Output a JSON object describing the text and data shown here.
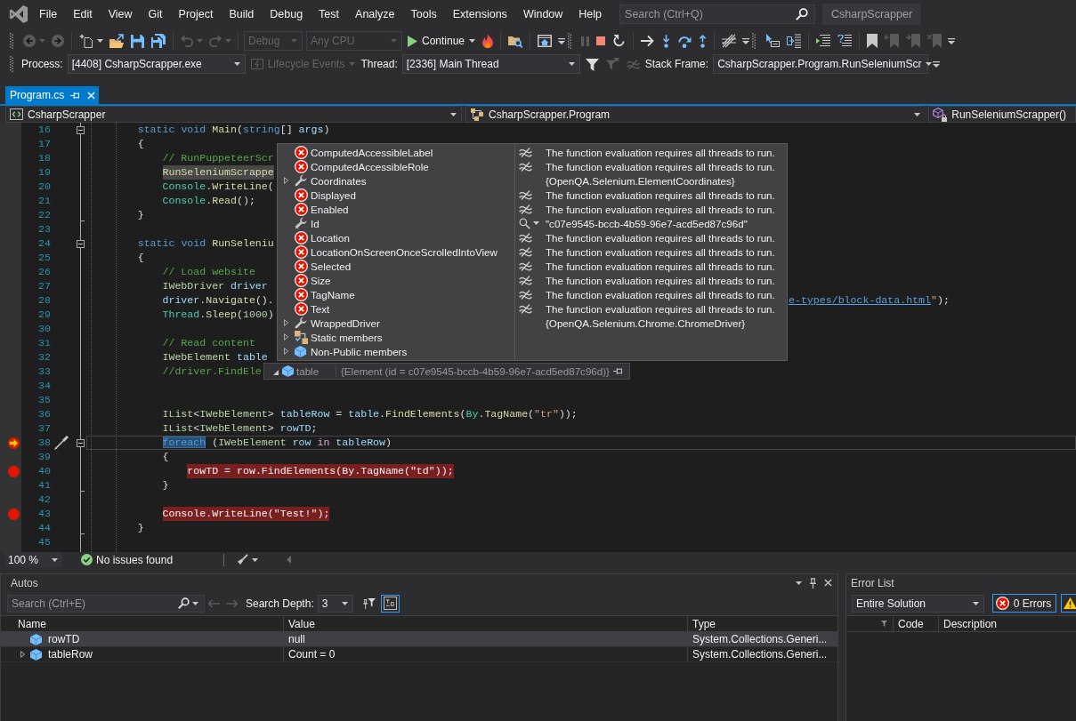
{
  "menu_bar": {
    "items": [
      "File",
      "Edit",
      "View",
      "Git",
      "Project",
      "Build",
      "Debug",
      "Test",
      "Analyze",
      "Tools",
      "Extensions",
      "Window",
      "Help"
    ],
    "search": {
      "placeholder": "Search (Ctrl+Q)"
    },
    "solution_name": "CsharpScrapper"
  },
  "toolbars": [
    [
      [
        [
          {
            "kind": "back",
            "disabled": true
          },
          {
            "kind": "caret",
            "disabled": true
          },
          {
            "kind": "forward",
            "disabled": true
          }
        ],
        [
          {
            "kind": "new_project",
            "disabled": false
          },
          {
            "kind": "caret",
            "disabled": false
          },
          {
            "kind": "open",
            "disabled": false
          },
          {
            "kind": "save",
            "disabled": false
          },
          {
            "kind": "save_all",
            "disabled": false
          }
        ],
        [
          {
            "kind": "undo",
            "disabled": true
          },
          {
            "kind": "caret",
            "disabled": true
          },
          {
            "kind": "redo",
            "disabled": true
          },
          {
            "kind": "caret",
            "disabled": true
          }
        ],
        [
          {
            "kind": "combo",
            "value": "Debug",
            "disabled": true
          },
          {
            "kind": "combo",
            "value": "Any CPU",
            "disabled": true
          },
          {
            "kind": "continue",
            "label": "Continue",
            "disabled": false
          },
          {
            "kind": "hot_reload",
            "disabled": false
          }
        ],
        [
          {
            "kind": "find_folder",
            "disabled": false
          }
        ],
        [
          {
            "kind": "app_window",
            "disabled": false
          }
        ]
      ],
      [
        [
          {
            "kind": "pause",
            "disabled": true
          },
          {
            "kind": "stop",
            "disabled": false
          },
          {
            "kind": "restart",
            "disabled": false
          }
        ],
        [
          {
            "kind": "show_next",
            "disabled": false
          },
          {
            "kind": "step_into",
            "disabled": false
          },
          {
            "kind": "step_over",
            "disabled": false
          },
          {
            "kind": "step_out",
            "disabled": false
          }
        ],
        [
          {
            "kind": "threads",
            "disabled": false
          }
        ]
      ],
      [
        [
          {
            "kind": "pointer_box",
            "disabled": false
          },
          {
            "kind": "stack_box",
            "disabled": false
          }
        ],
        [
          {
            "kind": "lines",
            "disabled": false
          },
          {
            "kind": "help_lines",
            "disabled": false
          }
        ],
        [
          {
            "kind": "bookmark",
            "disabled": false
          },
          {
            "kind": "bookmark_prev",
            "disabled": true
          },
          {
            "kind": "bookmark_next",
            "disabled": true
          },
          {
            "kind": "bookmark_clear",
            "disabled": true
          }
        ]
      ]
    ],
    [
      [
        [
          {
            "kind": "label",
            "text": "Process:"
          },
          {
            "kind": "combo",
            "value": "[4408] CsharpScrapper.exe",
            "disabled": false
          },
          {
            "kind": "lifecycle",
            "label": "Lifecycle Events",
            "disabled": true
          },
          {
            "kind": "label",
            "text": "Thread:"
          },
          {
            "kind": "combo",
            "value": "[2336] Main Thread",
            "disabled": false
          },
          {
            "kind": "filter",
            "disabled": false
          },
          {
            "kind": "flag_filter",
            "disabled": true
          },
          {
            "kind": "flag_clear",
            "disabled": true
          },
          {
            "kind": "label",
            "text": "Stack Frame:"
          },
          {
            "kind": "combo",
            "value": "CsharpScrapper.Program.RunSeleniumScr",
            "disabled": false
          }
        ]
      ]
    ]
  ],
  "document_tabs": [
    {
      "label": "Program.cs",
      "selected": true
    }
  ],
  "navigation_bar": [
    {
      "kind": "project",
      "text": "CsharpScrapper"
    },
    {
      "kind": "class",
      "text": "CsharpScrapper.Program"
    },
    {
      "kind": "method",
      "text": "RunSeleniumScrapper()"
    }
  ],
  "editor": {
    "lines": [
      {
        "number": "16",
        "kind": "fold_start",
        "breakpoint": false,
        "current": false,
        "call_site": false,
        "code": [
          {
            "text": "        static ",
            "kind": "keyword"
          },
          {
            "text": "void ",
            "kind": "keyword"
          },
          {
            "text": "Main",
            "kind": "method"
          },
          {
            "text": "(",
            "kind": "punct"
          },
          {
            "text": "string",
            "kind": "keyword"
          },
          {
            "text": "[] ",
            "kind": "punct"
          },
          {
            "text": "args",
            "kind": "variable"
          },
          {
            "text": ")",
            "kind": "punct"
          }
        ]
      },
      {
        "number": "17",
        "kind": "plain",
        "breakpoint": false,
        "current": false,
        "call_site": false,
        "code": [
          {
            "text": "        {",
            "kind": "punct"
          }
        ]
      },
      {
        "number": "18",
        "kind": "plain",
        "breakpoint": false,
        "current": false,
        "call_site": false,
        "code": [
          {
            "text": "            // RunPuppeteerScr",
            "kind": "comment"
          }
        ]
      },
      {
        "number": "19",
        "kind": "plain",
        "breakpoint": false,
        "current": false,
        "call_site": true,
        "code": [
          {
            "text": "            RunSeleniumScrappe",
            "kind": "method"
          }
        ]
      },
      {
        "number": "20",
        "kind": "plain",
        "breakpoint": false,
        "current": false,
        "call_site": false,
        "code": [
          {
            "text": "            Console",
            "kind": "type"
          },
          {
            "text": ".",
            "kind": "punct"
          },
          {
            "text": "WriteLine",
            "kind": "method"
          },
          {
            "text": "(",
            "kind": "punct"
          }
        ]
      },
      {
        "number": "21",
        "kind": "plain",
        "breakpoint": false,
        "current": false,
        "call_site": false,
        "code": [
          {
            "text": "            Console",
            "kind": "type"
          },
          {
            "text": ".",
            "kind": "punct"
          },
          {
            "text": "Read",
            "kind": "method"
          },
          {
            "text": "();",
            "kind": "punct"
          }
        ]
      },
      {
        "number": "22",
        "kind": "block_end",
        "breakpoint": false,
        "current": false,
        "call_site": false,
        "code": [
          {
            "text": "        }",
            "kind": "punct"
          }
        ]
      },
      {
        "number": "23",
        "kind": "plain",
        "breakpoint": false,
        "current": false,
        "call_site": false
      },
      {
        "number": "24",
        "kind": "fold_start",
        "breakpoint": false,
        "current": false,
        "call_site": false,
        "code": [
          {
            "text": "        static ",
            "kind": "keyword"
          },
          {
            "text": "void ",
            "kind": "keyword"
          },
          {
            "text": "RunSeleniu",
            "kind": "method"
          }
        ]
      },
      {
        "number": "25",
        "kind": "plain",
        "breakpoint": false,
        "current": false,
        "call_site": false,
        "code": [
          {
            "text": "        {",
            "kind": "punct"
          }
        ]
      },
      {
        "number": "26",
        "kind": "plain",
        "breakpoint": false,
        "current": false,
        "call_site": false,
        "code": [
          {
            "text": "            // Load website",
            "kind": "comment"
          }
        ]
      },
      {
        "number": "27",
        "kind": "plain",
        "breakpoint": false,
        "current": false,
        "call_site": false,
        "code": [
          {
            "text": "            IWebDriver ",
            "kind": "interface"
          },
          {
            "text": "driver",
            "kind": "variable"
          }
        ]
      },
      {
        "number": "28",
        "kind": "plain",
        "breakpoint": false,
        "current": false,
        "call_site": false,
        "code": [
          {
            "text": "            driver",
            "kind": "variable"
          },
          {
            "text": ".",
            "kind": "punct"
          },
          {
            "text": "Navigate",
            "kind": "method"
          },
          {
            "text": "().",
            "kind": "punct"
          }
        ],
        "after_tip": [
          {
            "text": "e-types/block-data.html",
            "kind": "link"
          },
          {
            "text": "\"",
            "kind": "string"
          },
          {
            "text": ");",
            "kind": "punct"
          }
        ]
      },
      {
        "number": "29",
        "kind": "plain",
        "breakpoint": false,
        "current": false,
        "call_site": false,
        "code": [
          {
            "text": "            Thread",
            "kind": "type"
          },
          {
            "text": ".",
            "kind": "punct"
          },
          {
            "text": "Sleep",
            "kind": "method"
          },
          {
            "text": "(",
            "kind": "punct"
          },
          {
            "text": "1000",
            "kind": "number"
          },
          {
            "text": ")",
            "kind": "punct"
          }
        ]
      },
      {
        "number": "30",
        "kind": "plain",
        "breakpoint": false,
        "current": false,
        "call_site": false
      },
      {
        "number": "31",
        "kind": "plain",
        "breakpoint": false,
        "current": false,
        "call_site": false,
        "code": [
          {
            "text": "            // Read content",
            "kind": "comment"
          }
        ]
      },
      {
        "number": "32",
        "kind": "plain",
        "breakpoint": false,
        "current": false,
        "call_site": false,
        "code": [
          {
            "text": "            IWebElement ",
            "kind": "interface"
          },
          {
            "text": "table",
            "kind": "variable"
          }
        ]
      },
      {
        "number": "33",
        "kind": "plain",
        "breakpoint": false,
        "current": false,
        "call_site": false,
        "code": [
          {
            "text": "            //driver.FindEle",
            "kind": "comment"
          }
        ]
      },
      {
        "number": "34",
        "kind": "plain",
        "breakpoint": false,
        "current": false,
        "call_site": false
      },
      {
        "number": "35",
        "kind": "plain",
        "breakpoint": false,
        "current": false,
        "call_site": false
      },
      {
        "number": "36",
        "kind": "plain",
        "breakpoint": false,
        "current": false,
        "call_site": false,
        "code": [
          {
            "text": "            IList",
            "kind": "interface"
          },
          {
            "text": "<",
            "kind": "punct"
          },
          {
            "text": "IWebElement",
            "kind": "interface"
          },
          {
            "text": "> ",
            "kind": "punct"
          },
          {
            "text": "tableRow",
            "kind": "variable"
          },
          {
            "text": " = ",
            "kind": "punct"
          },
          {
            "text": "table",
            "kind": "variable"
          },
          {
            "text": ".",
            "kind": "punct"
          },
          {
            "text": "FindElements",
            "kind": "method"
          },
          {
            "text": "(",
            "kind": "punct"
          },
          {
            "text": "By",
            "kind": "type"
          },
          {
            "text": ".",
            "kind": "punct"
          },
          {
            "text": "TagName",
            "kind": "method"
          },
          {
            "text": "(",
            "kind": "punct"
          },
          {
            "text": "\"tr\"",
            "kind": "string"
          },
          {
            "text": "));",
            "kind": "punct"
          }
        ]
      },
      {
        "number": "37",
        "kind": "plain",
        "breakpoint": false,
        "current": false,
        "call_site": false,
        "code": [
          {
            "text": "            IList",
            "kind": "interface"
          },
          {
            "text": "<",
            "kind": "punct"
          },
          {
            "text": "IWebElement",
            "kind": "interface"
          },
          {
            "text": "> ",
            "kind": "punct"
          },
          {
            "text": "rowTD",
            "kind": "variable"
          },
          {
            "text": ";",
            "kind": "punct"
          }
        ]
      },
      {
        "number": "38",
        "kind": "fold_start",
        "breakpoint": true,
        "current": true,
        "call_site": false,
        "code": [
          {
            "text": "            foreach",
            "kind": "selected"
          },
          {
            "text": " (",
            "kind": "punct"
          },
          {
            "text": "IWebElement ",
            "kind": "interface"
          },
          {
            "text": "row ",
            "kind": "variable"
          },
          {
            "text": "in ",
            "kind": "control"
          },
          {
            "text": "tableRow",
            "kind": "variable"
          },
          {
            "text": ")",
            "kind": "punct"
          }
        ]
      },
      {
        "number": "39",
        "kind": "plain",
        "breakpoint": false,
        "current": false,
        "call_site": false,
        "code": [
          {
            "text": "            {",
            "kind": "punct"
          }
        ]
      },
      {
        "number": "40",
        "kind": "plain",
        "breakpoint": true,
        "current": false,
        "call_site": false,
        "code": [
          {
            "text": "                rowTD",
            "kind": "variable"
          },
          {
            "text": " = ",
            "kind": "punct"
          },
          {
            "text": "row",
            "kind": "variable"
          },
          {
            "text": ".",
            "kind": "punct"
          },
          {
            "text": "FindElements",
            "kind": "method"
          },
          {
            "text": "(",
            "kind": "punct"
          },
          {
            "text": "By",
            "kind": "type"
          },
          {
            "text": ".",
            "kind": "punct"
          },
          {
            "text": "TagName",
            "kind": "method"
          },
          {
            "text": "(",
            "kind": "punct"
          },
          {
            "text": "\"td\"",
            "kind": "string"
          },
          {
            "text": "));",
            "kind": "punct"
          }
        ]
      },
      {
        "number": "41",
        "kind": "block_end",
        "breakpoint": false,
        "current": false,
        "call_site": false,
        "code": [
          {
            "text": "            }",
            "kind": "punct"
          }
        ]
      },
      {
        "number": "42",
        "kind": "plain",
        "breakpoint": false,
        "current": false,
        "call_site": false
      },
      {
        "number": "43",
        "kind": "plain",
        "breakpoint": true,
        "current": false,
        "call_site": false,
        "code": [
          {
            "text": "            Console",
            "kind": "type"
          },
          {
            "text": ".",
            "kind": "punct"
          },
          {
            "text": "WriteLine",
            "kind": "method"
          },
          {
            "text": "(",
            "kind": "punct"
          },
          {
            "text": "\"Test!\"",
            "kind": "string"
          },
          {
            "text": ");",
            "kind": "punct"
          }
        ]
      },
      {
        "number": "44",
        "kind": "block_end",
        "breakpoint": false,
        "current": false,
        "call_site": false,
        "code": [
          {
            "text": "        }",
            "kind": "punct"
          }
        ]
      },
      {
        "number": "45",
        "kind": "plain",
        "breakpoint": false,
        "current": false,
        "call_site": false
      }
    ]
  },
  "data_tip": {
    "name": "table",
    "value": "{Element (id = c07e9545-bccb-4b59-96e7-acd5ed87c96d)}",
    "expanded": true,
    "members": [
      {
        "name": "ComputedAccessibleLabel",
        "kind": "error",
        "expandable": false,
        "value": "The function evaluation requires all threads to run."
      },
      {
        "name": "ComputedAccessibleRole",
        "kind": "error",
        "expandable": false,
        "value": "The function evaluation requires all threads to run."
      },
      {
        "name": "Coordinates",
        "kind": "property",
        "expandable": true,
        "value": "{OpenQA.Selenium.ElementCoordinates}"
      },
      {
        "name": "Displayed",
        "kind": "error",
        "expandable": false,
        "value": "The function evaluation requires all threads to run."
      },
      {
        "name": "Enabled",
        "kind": "error",
        "expandable": false,
        "value": "The function evaluation requires all threads to run."
      },
      {
        "name": "Id",
        "kind": "visualizer",
        "expandable": false,
        "value": "\"c07e9545-bccb-4b59-96e7-acd5ed87c96d\""
      },
      {
        "name": "Location",
        "kind": "error",
        "expandable": false,
        "value": "The function evaluation requires all threads to run."
      },
      {
        "name": "LocationOnScreenOnceScrolledIntoView",
        "kind": "error",
        "expandable": false,
        "value": "The function evaluation requires all threads to run."
      },
      {
        "name": "Selected",
        "kind": "error",
        "expandable": false,
        "value": "The function evaluation requires all threads to run."
      },
      {
        "name": "Size",
        "kind": "error",
        "expandable": false,
        "value": "The function evaluation requires all threads to run."
      },
      {
        "name": "TagName",
        "kind": "error",
        "expandable": false,
        "value": "The function evaluation requires all threads to run."
      },
      {
        "name": "Text",
        "kind": "error",
        "expandable": false,
        "value": "The function evaluation requires all threads to run."
      },
      {
        "name": "WrappedDriver",
        "kind": "property",
        "expandable": true,
        "value": "{OpenQA.Selenium.Chrome.ChromeDriver}"
      },
      {
        "name": "Static members",
        "kind": "static",
        "expandable": true
      },
      {
        "name": "Non-Public members",
        "kind": "nonpublic",
        "expandable": true
      }
    ]
  },
  "editor_status": {
    "zoom": "100 %",
    "issues": "No issues found"
  },
  "autos": {
    "title": "Autos",
    "search": {
      "placeholder": "Search (Ctrl+E)"
    },
    "navigation": [
      {
        "kind": "back",
        "disabled": true
      },
      {
        "kind": "forward",
        "disabled": true
      }
    ],
    "depth_label": "Search Depth:",
    "depth": "3",
    "toggles": [
      {
        "kind": "filter",
        "selected": false
      },
      {
        "kind": "tab",
        "selected": true
      }
    ],
    "columns": [
      "Name",
      "Value",
      "Type"
    ],
    "rows": [
      {
        "name": "rowTD",
        "value": "null",
        "type": "System.Collections.Generi...",
        "selected": true,
        "expandable": false
      },
      {
        "name": "tableRow",
        "value": "Count = 0",
        "type": "System.Collections.Generi...",
        "selected": false,
        "expandable": true
      }
    ]
  },
  "error_list": {
    "title": "Error List",
    "scope": "Entire Solution",
    "filters": [
      {
        "kind": "errors",
        "label": "0 Errors",
        "selected": true
      },
      {
        "kind": "warnings",
        "selected": true
      }
    ],
    "columns": [
      "Code",
      "Description"
    ]
  }
}
